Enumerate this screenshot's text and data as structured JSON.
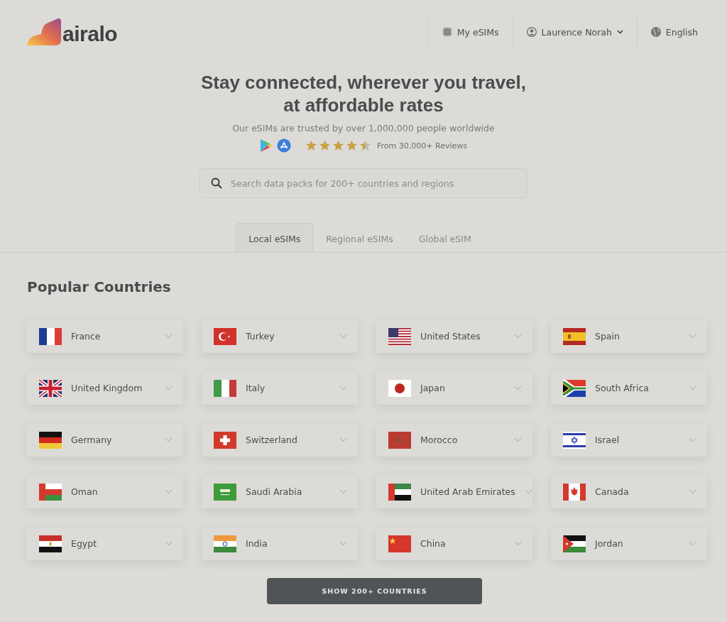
{
  "header": {
    "logo": "airalo",
    "nav": [
      {
        "kind": "chip",
        "label": "My eSIMs"
      },
      {
        "kind": "user",
        "label": "Laurence Norah"
      },
      {
        "kind": "globe",
        "label": "English"
      }
    ]
  },
  "hero": {
    "title": "Stay connected, wherever you travel, at affordable rates",
    "subtitle": "Our eSIMs are trusted by over 1,000,000 people worldwide",
    "stars": 4.5,
    "reviews": "From 30,000+ Reviews"
  },
  "search": {
    "placeholder": "Search data packs for 200+ countries and regions"
  },
  "tabs": [
    {
      "label": "Local eSIMs",
      "selected": true
    },
    {
      "label": "Regional eSIMs",
      "selected": false
    },
    {
      "label": "Global eSIM",
      "selected": false
    }
  ],
  "section_title": "Popular Countries",
  "countries": [
    {
      "name": "France",
      "kind": "fr"
    },
    {
      "name": "Turkey",
      "kind": "tr"
    },
    {
      "name": "United States",
      "kind": "us"
    },
    {
      "name": "Spain",
      "kind": "es"
    },
    {
      "name": "United Kingdom",
      "kind": "gb"
    },
    {
      "name": "Italy",
      "kind": "it"
    },
    {
      "name": "Japan",
      "kind": "jp"
    },
    {
      "name": "South Africa",
      "kind": "za"
    },
    {
      "name": "Germany",
      "kind": "de"
    },
    {
      "name": "Switzerland",
      "kind": "ch"
    },
    {
      "name": "Morocco",
      "kind": "ma"
    },
    {
      "name": "Israel",
      "kind": "il"
    },
    {
      "name": "Oman",
      "kind": "om"
    },
    {
      "name": "Saudi Arabia",
      "kind": "sa"
    },
    {
      "name": "United Arab Emirates",
      "kind": "ae"
    },
    {
      "name": "Canada",
      "kind": "ca"
    },
    {
      "name": "Egypt",
      "kind": "eg"
    },
    {
      "name": "India",
      "kind": "in"
    },
    {
      "name": "China",
      "kind": "cn"
    },
    {
      "name": "Jordan",
      "kind": "jo"
    }
  ],
  "show_more": "SHOW 200+ COUNTRIES"
}
